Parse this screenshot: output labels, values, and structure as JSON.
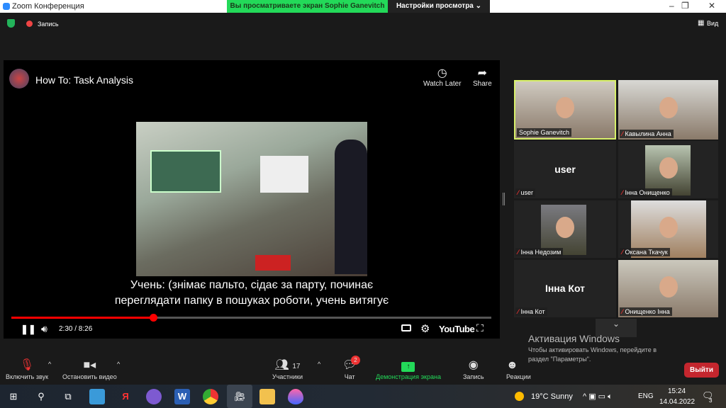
{
  "window": {
    "title": "Zoom Конференция",
    "minimize": "–",
    "restore": "❐",
    "close": "✕"
  },
  "banner": {
    "viewing": "Вы просматриваете экран Sophie Ganevitch",
    "view_options": "Настройки просмотра ⌄"
  },
  "topbar": {
    "record": "Запись",
    "view": "Вид"
  },
  "youtube": {
    "title": "How To: Task Analysis",
    "watch_later": "Watch Later",
    "share": "Share",
    "subtitle_line1": "Учень: (знімає пальто, сідає за парту, починає",
    "subtitle_line2": "переглядати папку в пошуках роботи, учень витягує",
    "time": "2:30 / 8:26",
    "progress_percent": 29.6,
    "logo": "YouTube"
  },
  "participants": [
    {
      "name": "Sophie Ganevitch",
      "active": true
    },
    {
      "name": "Кавылина Анна"
    },
    {
      "name": "user",
      "big": "user"
    },
    {
      "name": "Інна Онищенко"
    },
    {
      "name": "Інна Недозим"
    },
    {
      "name": "Оксана Ткачук"
    },
    {
      "name": "Інна Кот",
      "big": "Інна Кот"
    },
    {
      "name": "Онищенко Інна"
    }
  ],
  "toolbar": {
    "unmute": "Включить звук",
    "stop_video": "Остановить видео",
    "participants": "Участники",
    "participants_count": "17",
    "chat": "Чат",
    "chat_badge": "2",
    "share_screen": "Демонстрация экрана",
    "record": "Запись",
    "reactions": "Реакции",
    "leave": "Выйти"
  },
  "activation": {
    "title": "Активация Windows",
    "line1": "Чтобы активировать Windows, перейдите в",
    "line2": "раздел \"Параметры\"."
  },
  "taskbar": {
    "weather": "19°C  Sunny",
    "lang": "ENG",
    "time": "15:24",
    "date": "14.04.2022",
    "notifications": "3"
  },
  "colors": {
    "accent_green": "#23d959",
    "leave_red": "#c4262e",
    "active_border": "#d8f06a"
  }
}
